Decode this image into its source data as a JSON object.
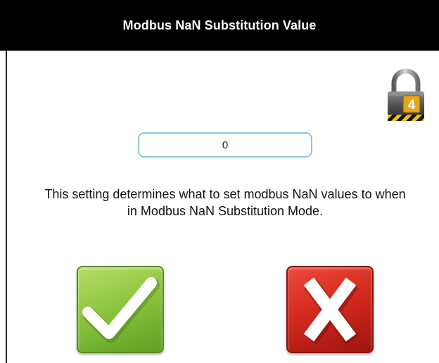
{
  "dialog": {
    "title": "Modbus NaN Substitution Value",
    "lock_level": "4",
    "value_field": {
      "value": "0"
    },
    "description": "This setting determines what to set modbus NaN values to when in Modbus NaN Substitution Mode.",
    "buttons": {
      "ok_icon": "checkmark-icon",
      "cancel_icon": "x-icon"
    },
    "colors": {
      "title_bar": "#000000",
      "field_border": "#8fc3e4",
      "ok_green": "#8cc63f",
      "cancel_red": "#d0281c",
      "lock_badge": "#e8a317"
    }
  }
}
